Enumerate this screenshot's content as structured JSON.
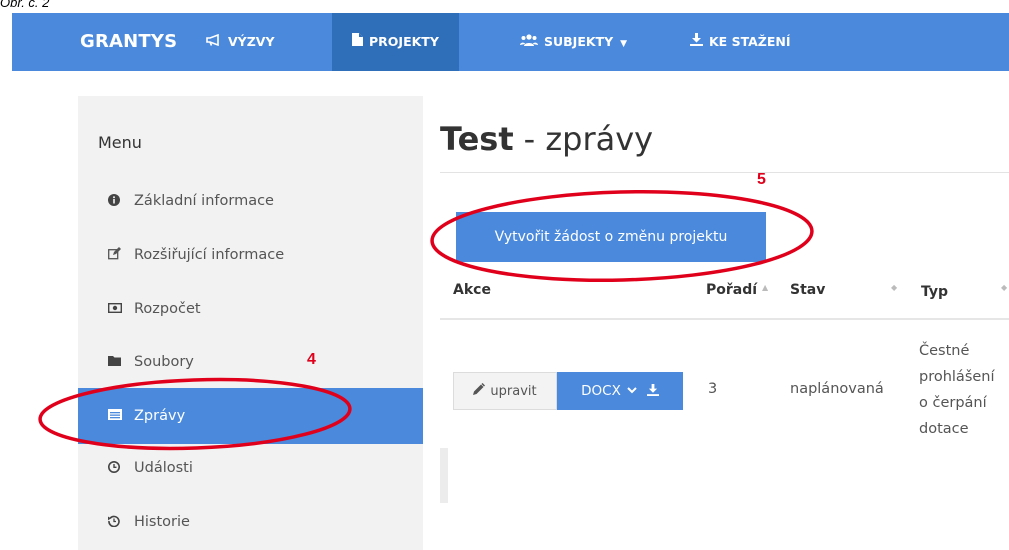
{
  "caption": "Obr. č. 2",
  "navbar": {
    "brand": "GRANTYS",
    "items": [
      {
        "label": "VÝZVY",
        "icon": "megaphone-icon",
        "active": false
      },
      {
        "label": "PROJEKTY",
        "icon": "document-icon",
        "active": true
      },
      {
        "label": "SUBJEKTY",
        "icon": "users-icon",
        "active": false,
        "dropdown": true
      },
      {
        "label": "KE STAŽENÍ",
        "icon": "download-icon",
        "active": false
      }
    ]
  },
  "sidebar": {
    "title": "Menu",
    "items": [
      {
        "label": "Základní informace",
        "icon": "info-circle-icon"
      },
      {
        "label": "Rozšiřující informace",
        "icon": "edit-icon"
      },
      {
        "label": "Rozpočet",
        "icon": "money-icon"
      },
      {
        "label": "Soubory",
        "icon": "folder-icon"
      },
      {
        "label": "Zprávy",
        "icon": "list-alt-icon",
        "active": true
      },
      {
        "label": "Události",
        "icon": "clock-icon"
      },
      {
        "label": "Historie",
        "icon": "history-icon"
      }
    ]
  },
  "main": {
    "title_bold": "Test",
    "title_rest": "- zprávy",
    "create_button": "Vytvořit žádost o změnu projektu",
    "columns": [
      "Akce",
      "Pořadí",
      "Stav",
      "Typ"
    ],
    "row": {
      "edit_label": "upravit",
      "docx_label": "DOCX",
      "poradi": "3",
      "stav": "naplánovaná",
      "typ_lines": [
        "Čestné",
        "prohlášení",
        "o čerpání",
        "dotace"
      ]
    }
  },
  "annotations": {
    "sidebar_marker": "4",
    "button_marker": "5",
    "color": "#e0001b"
  },
  "colors": {
    "brand_blue": "#4a89dc",
    "active_nav": "#2f6fba"
  }
}
